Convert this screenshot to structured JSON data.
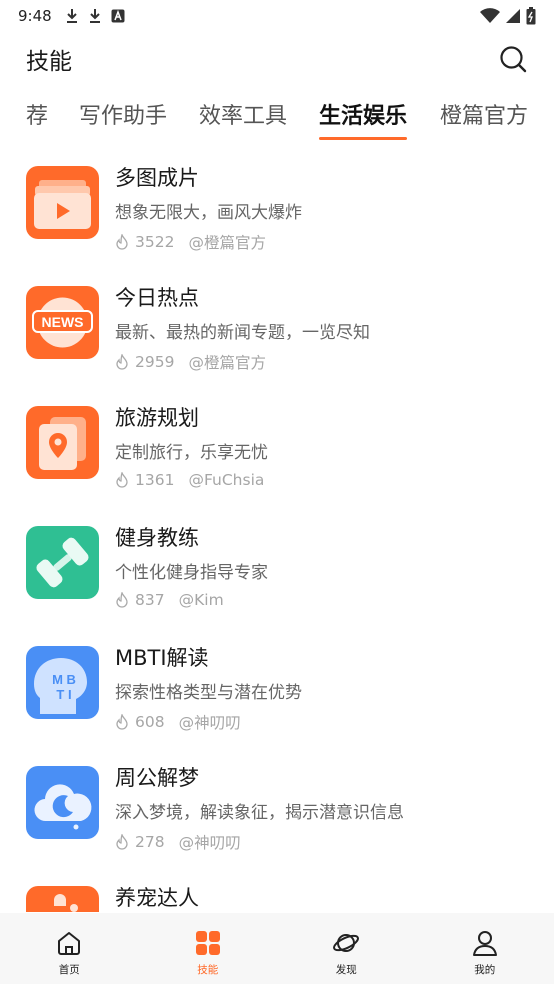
{
  "status_bar": {
    "time": "9:48"
  },
  "header": {
    "title": "技能"
  },
  "tabs": [
    {
      "label": "荐"
    },
    {
      "label": "写作助手"
    },
    {
      "label": "效率工具"
    },
    {
      "label": "生活娱乐",
      "active": true
    },
    {
      "label": "橙篇官方"
    }
  ],
  "skills": [
    {
      "title": "多图成片",
      "desc": "想象无限大，画风大爆炸",
      "count": "3522",
      "author": "@橙篇官方",
      "icon": "video-play-icon"
    },
    {
      "title": "今日热点",
      "desc": "最新、最热的新闻专题，一览尽知",
      "count": "2959",
      "author": "@橙篇官方",
      "icon": "news-icon",
      "icon_text": "NEWS"
    },
    {
      "title": "旅游规划",
      "desc": "定制旅行，乐享无忧",
      "count": "1361",
      "author": "@FuChsia",
      "icon": "map-pin-icon"
    },
    {
      "title": "健身教练",
      "desc": "个性化健身指导专家",
      "count": "837",
      "author": "@Kim",
      "icon": "dumbbell-icon"
    },
    {
      "title": "MBTI解读",
      "desc": "探索性格类型与潜在优势",
      "count": "608",
      "author": "@神叨叨",
      "icon": "mbti-head-icon",
      "icon_text_top": "M B",
      "icon_text_bottom": "T I"
    },
    {
      "title": "周公解梦",
      "desc": "深入梦境，解读象征，揭示潜意识信息",
      "count": "278",
      "author": "@神叨叨",
      "icon": "moon-cloud-icon"
    },
    {
      "title": "养宠达人",
      "desc": "",
      "count": "",
      "author": "",
      "icon": "pet-icon"
    }
  ],
  "bottom_nav": [
    {
      "label": "首页",
      "icon": "home-icon"
    },
    {
      "label": "技能",
      "icon": "skills-grid-icon",
      "active": true
    },
    {
      "label": "发现",
      "icon": "planet-icon"
    },
    {
      "label": "我的",
      "icon": "person-icon"
    }
  ],
  "colors": {
    "accent": "#ff6a2a",
    "teal": "#2fbf93",
    "blue": "#4a8ff5"
  }
}
